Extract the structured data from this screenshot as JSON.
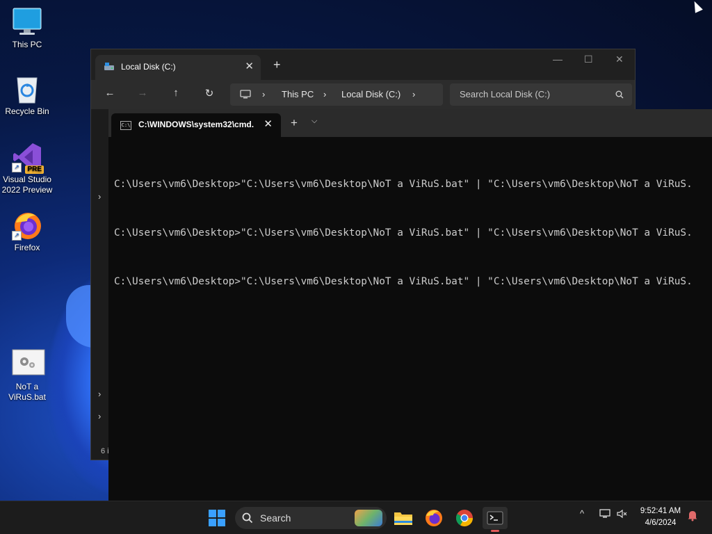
{
  "desktop": {
    "icons": [
      {
        "label": "This PC"
      },
      {
        "label": "Recycle Bin"
      },
      {
        "label": "Visual Studio 2022 Preview",
        "badge": "PRE"
      },
      {
        "label": "Firefox"
      },
      {
        "label": "NoT a ViRuS.bat"
      }
    ]
  },
  "explorer": {
    "tab_title": "Local Disk (C:)",
    "breadcrumb": [
      "This PC",
      "Local Disk (C:)"
    ],
    "search_placeholder": "Search Local Disk (C:)",
    "status_text": "6 i"
  },
  "terminal": {
    "tab_title": "C:\\WINDOWS\\system32\\cmd.",
    "lines": [
      "C:\\Users\\vm6\\Desktop>\"C:\\Users\\vm6\\Desktop\\NoT a ViRuS.bat\" | \"C:\\Users\\vm6\\Desktop\\NoT a ViRuS.",
      "C:\\Users\\vm6\\Desktop>\"C:\\Users\\vm6\\Desktop\\NoT a ViRuS.bat\" | \"C:\\Users\\vm6\\Desktop\\NoT a ViRuS.",
      "C:\\Users\\vm6\\Desktop>\"C:\\Users\\vm6\\Desktop\\NoT a ViRuS.bat\" | \"C:\\Users\\vm6\\Desktop\\NoT a ViRuS."
    ]
  },
  "taskbar": {
    "search_placeholder": "Search",
    "time": "9:52:41 AM",
    "date": "4/6/2024"
  },
  "colors": {
    "accent": "#0078d4",
    "terminal_bg": "#0c0c0c",
    "taskbar_bg": "#1c1c1c"
  }
}
